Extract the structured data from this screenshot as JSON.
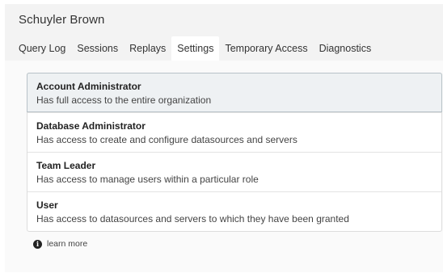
{
  "header": {
    "user_name": "Schuyler Brown"
  },
  "tabs": [
    {
      "label": "Query Log"
    },
    {
      "label": "Sessions"
    },
    {
      "label": "Replays"
    },
    {
      "label": "Settings",
      "active": true
    },
    {
      "label": "Temporary Access"
    },
    {
      "label": "Diagnostics"
    }
  ],
  "roles": [
    {
      "name": "Account Administrator",
      "description": "Has full access to the entire organization",
      "selected": true
    },
    {
      "name": "Database Administrator",
      "description": "Has access to create and configure datasources and servers"
    },
    {
      "name": "Team Leader",
      "description": "Has access to manage users within a particular role"
    },
    {
      "name": "User",
      "description": "Has access to datasources and servers to which they have been granted"
    }
  ],
  "learn_more": {
    "icon": "info-icon",
    "label": "learn more"
  }
}
